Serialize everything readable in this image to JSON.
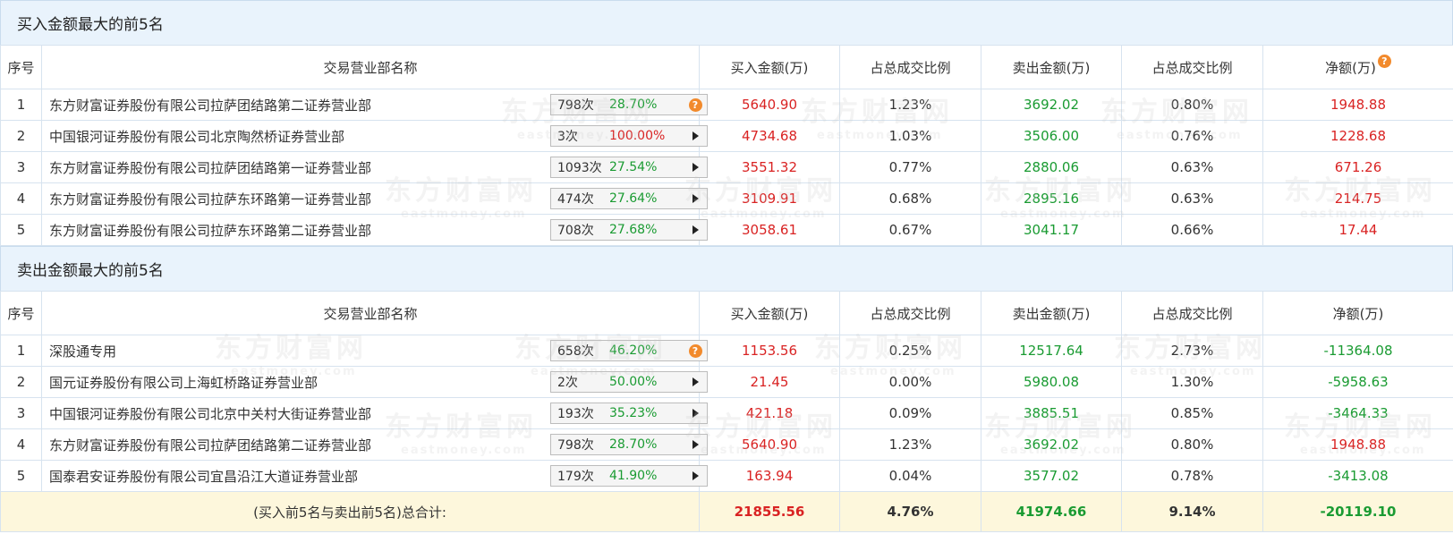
{
  "buy_section": {
    "title": "买入金额最大的前5名",
    "headers": [
      "序号",
      "交易营业部名称",
      "买入金额(万)",
      "占总成交比例",
      "卖出金额(万)",
      "占总成交比例",
      "净额(万)"
    ],
    "rows": [
      {
        "idx": "1",
        "name": "东方财富证券股份有限公司拉萨团结路第二证券营业部",
        "count": "798次",
        "pct": "28.70%",
        "pct_color": "green",
        "ctrl": "help",
        "buy": "5640.90",
        "buy_ratio": "1.23%",
        "sell": "3692.02",
        "sell_ratio": "0.80%",
        "net": "1948.88",
        "net_color": "red"
      },
      {
        "idx": "2",
        "name": "中国银河证券股份有限公司北京陶然桥证券营业部",
        "count": "3次",
        "pct": "100.00%",
        "pct_color": "red",
        "ctrl": "play",
        "buy": "4734.68",
        "buy_ratio": "1.03%",
        "sell": "3506.00",
        "sell_ratio": "0.76%",
        "net": "1228.68",
        "net_color": "red"
      },
      {
        "idx": "3",
        "name": "东方财富证券股份有限公司拉萨团结路第一证券营业部",
        "count": "1093次",
        "pct": "27.54%",
        "pct_color": "green",
        "ctrl": "play",
        "buy": "3551.32",
        "buy_ratio": "0.77%",
        "sell": "2880.06",
        "sell_ratio": "0.63%",
        "net": "671.26",
        "net_color": "red"
      },
      {
        "idx": "4",
        "name": "东方财富证券股份有限公司拉萨东环路第一证券营业部",
        "count": "474次",
        "pct": "27.64%",
        "pct_color": "green",
        "ctrl": "play",
        "buy": "3109.91",
        "buy_ratio": "0.68%",
        "sell": "2895.16",
        "sell_ratio": "0.63%",
        "net": "214.75",
        "net_color": "red"
      },
      {
        "idx": "5",
        "name": "东方财富证券股份有限公司拉萨东环路第二证券营业部",
        "count": "708次",
        "pct": "27.68%",
        "pct_color": "green",
        "ctrl": "play",
        "buy": "3058.61",
        "buy_ratio": "0.67%",
        "sell": "3041.17",
        "sell_ratio": "0.66%",
        "net": "17.44",
        "net_color": "red"
      }
    ]
  },
  "sell_section": {
    "title": "卖出金额最大的前5名",
    "headers": [
      "序号",
      "交易营业部名称",
      "买入金额(万)",
      "占总成交比例",
      "卖出金额(万)",
      "占总成交比例",
      "净额(万)"
    ],
    "rows": [
      {
        "idx": "1",
        "name": "深股通专用",
        "count": "658次",
        "pct": "46.20%",
        "pct_color": "green",
        "ctrl": "help",
        "buy": "1153.56",
        "buy_ratio": "0.25%",
        "sell": "12517.64",
        "sell_ratio": "2.73%",
        "net": "-11364.08",
        "net_color": "green"
      },
      {
        "idx": "2",
        "name": "国元证券股份有限公司上海虹桥路证券营业部",
        "count": "2次",
        "pct": "50.00%",
        "pct_color": "green",
        "ctrl": "play",
        "buy": "21.45",
        "buy_ratio": "0.00%",
        "sell": "5980.08",
        "sell_ratio": "1.30%",
        "net": "-5958.63",
        "net_color": "green"
      },
      {
        "idx": "3",
        "name": "中国银河证券股份有限公司北京中关村大街证券营业部",
        "count": "193次",
        "pct": "35.23%",
        "pct_color": "green",
        "ctrl": "play",
        "buy": "421.18",
        "buy_ratio": "0.09%",
        "sell": "3885.51",
        "sell_ratio": "0.85%",
        "net": "-3464.33",
        "net_color": "green"
      },
      {
        "idx": "4",
        "name": "东方财富证券股份有限公司拉萨团结路第二证券营业部",
        "count": "798次",
        "pct": "28.70%",
        "pct_color": "green",
        "ctrl": "play",
        "buy": "5640.90",
        "buy_ratio": "1.23%",
        "sell": "3692.02",
        "sell_ratio": "0.80%",
        "net": "1948.88",
        "net_color": "red"
      },
      {
        "idx": "5",
        "name": "国泰君安证券股份有限公司宜昌沿江大道证券营业部",
        "count": "179次",
        "pct": "41.90%",
        "pct_color": "green",
        "ctrl": "play",
        "buy": "163.94",
        "buy_ratio": "0.04%",
        "sell": "3577.02",
        "sell_ratio": "0.78%",
        "net": "-3413.08",
        "net_color": "green"
      }
    ]
  },
  "total": {
    "label": "(买入前5名与卖出前5名)总合计:",
    "buy": "21855.56",
    "buy_ratio": "4.76%",
    "sell": "41974.66",
    "sell_ratio": "9.14%",
    "net": "-20119.10"
  },
  "watermark": {
    "cn": "东方财富网",
    "en": "eastmoney.com"
  },
  "help_glyph": "?",
  "colors": {
    "red": "#d92323",
    "green": "#1a9b32",
    "header_bg": "#e9f3fc",
    "total_bg": "#fdf7dc",
    "help_icon": "#f28a2c"
  }
}
